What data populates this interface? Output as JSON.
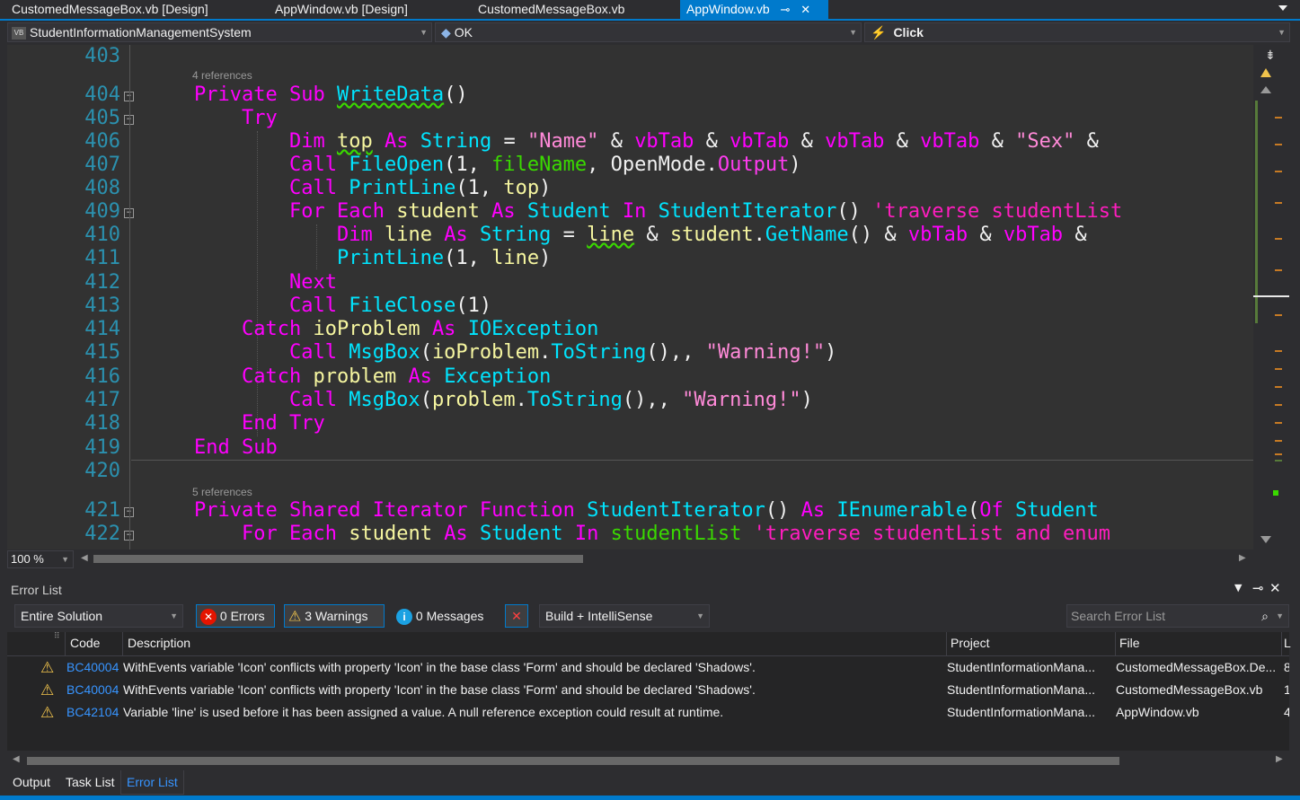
{
  "tabs": [
    {
      "label": "CustomedMessageBox.vb [Design]",
      "active": false
    },
    {
      "label": "AppWindow.vb [Design]",
      "active": false
    },
    {
      "label": "CustomedMessageBox.vb",
      "active": false
    },
    {
      "label": "AppWindow.vb",
      "active": true
    }
  ],
  "navbar": {
    "project": "StudentInformationManagementSystem",
    "object": "OK",
    "event": "Click"
  },
  "editor": {
    "zoom": "100 %",
    "refs_1": "4 references",
    "refs_2": "5 references",
    "lines": [
      {
        "n": "403"
      },
      {
        "n": "404"
      },
      {
        "n": "405"
      },
      {
        "n": "406"
      },
      {
        "n": "407"
      },
      {
        "n": "408"
      },
      {
        "n": "409"
      },
      {
        "n": "410"
      },
      {
        "n": "411"
      },
      {
        "n": "412"
      },
      {
        "n": "413"
      },
      {
        "n": "414"
      },
      {
        "n": "415"
      },
      {
        "n": "416"
      },
      {
        "n": "417"
      },
      {
        "n": "418"
      },
      {
        "n": "419"
      },
      {
        "n": "420"
      },
      {
        "n": "421"
      },
      {
        "n": "422"
      }
    ]
  },
  "error_list": {
    "title": "Error List",
    "scope": "Entire Solution",
    "errors": "0 Errors",
    "warnings": "3 Warnings",
    "messages": "0 Messages",
    "build": "Build + IntelliSense",
    "search_placeholder": "Search Error List",
    "columns": {
      "code": "Code",
      "description": "Description",
      "project": "Project",
      "file": "File",
      "line": "L"
    },
    "rows": [
      {
        "code": "BC40004",
        "description": "WithEvents variable 'Icon' conflicts with property 'Icon' in the base class 'Form' and should be declared 'Shadows'.",
        "project": "StudentInformationMana...",
        "file": "CustomedMessageBox.De...",
        "line": "8"
      },
      {
        "code": "BC40004",
        "description": "WithEvents variable 'Icon' conflicts with property 'Icon' in the base class 'Form' and should be declared 'Shadows'.",
        "project": "StudentInformationMana...",
        "file": "CustomedMessageBox.vb",
        "line": "1"
      },
      {
        "code": "BC42104",
        "description": "Variable 'line' is used before it has been assigned a value. A null reference exception could result at runtime.",
        "project": "StudentInformationMana...",
        "file": "AppWindow.vb",
        "line": "4"
      }
    ]
  },
  "bottom_tabs": [
    {
      "label": "Output",
      "active": false
    },
    {
      "label": "Task List",
      "active": false
    },
    {
      "label": "Error List",
      "active": true
    }
  ]
}
